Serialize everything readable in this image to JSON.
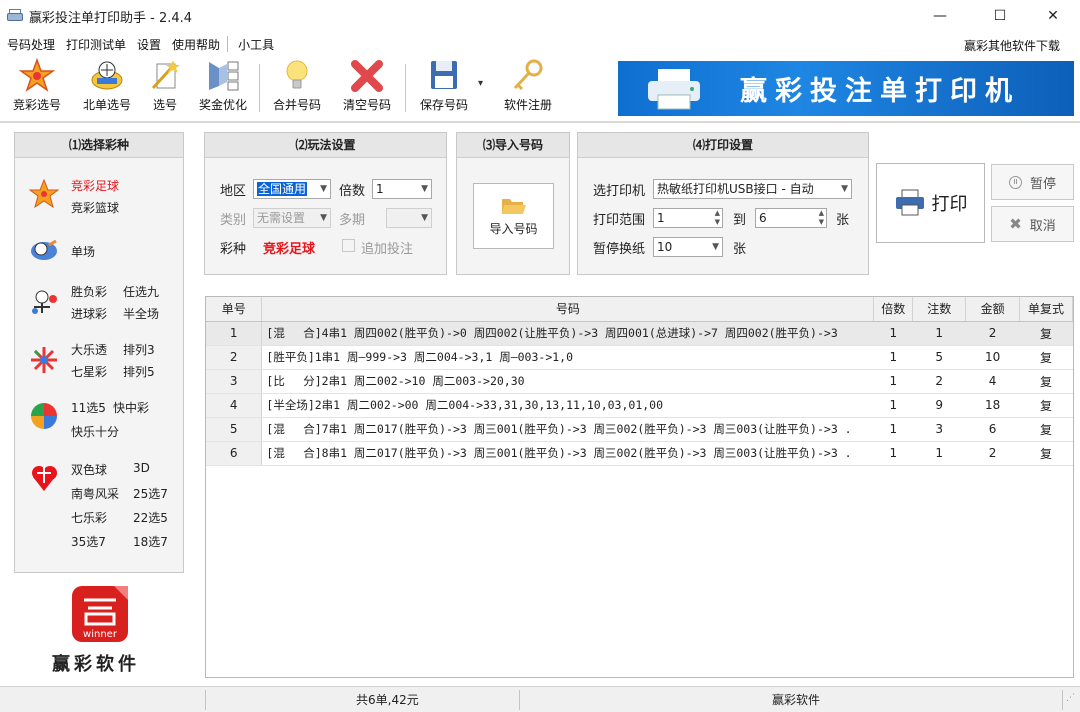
{
  "window": {
    "title": "赢彩投注单打印助手 - 2.4.4",
    "min": "—",
    "max": "☐",
    "close": "✕"
  },
  "menu": {
    "items": [
      "号码处理",
      "打印测试单",
      "设置",
      "使用帮助",
      "小工具"
    ],
    "right_link": "赢彩其他软件下载"
  },
  "toolbar": {
    "buttons": [
      "竞彩选号",
      "北单选号",
      "选号",
      "奖金优化",
      "合并号码",
      "清空号码",
      "保存号码",
      "软件注册"
    ],
    "save_dropdown": "▾"
  },
  "banner": {
    "text": "赢彩投注单打印机"
  },
  "sections": {
    "select_lottery": "⑴选择彩种",
    "play_settings": "⑵玩法设置",
    "import_numbers": "⑶导入号码",
    "print_settings": "⑷打印设置"
  },
  "lotteries": {
    "jingcai": [
      "竞彩足球",
      "竞彩篮球"
    ],
    "danchang": [
      "单场"
    ],
    "shengfu": [
      "胜负彩",
      "任选九",
      "进球彩",
      "半全场"
    ],
    "daletou": [
      "大乐透",
      "排列3",
      "七星彩",
      "排列5"
    ],
    "gaopin": [
      "11选5",
      "快中彩",
      "快乐十分"
    ],
    "fucai": [
      "双色球",
      "3D",
      "南粤风采",
      "25选7",
      "七乐彩",
      "22选5",
      "35选7",
      "18选7"
    ],
    "active_color": "#e8141b"
  },
  "logo": {
    "text": "赢彩软件",
    "badge": "winner"
  },
  "play": {
    "region_label": "地区",
    "region_value": "全国通用",
    "multiple_label": "倍数",
    "multiple_value": "1",
    "category_label": "类别",
    "category_value": "无需设置",
    "multi_period_label": "多期",
    "multi_period_value": "",
    "lottery_label": "彩种",
    "lottery_value": "竞彩足球",
    "extra_bet_label": "追加投注"
  },
  "import": {
    "button": "导入号码"
  },
  "print": {
    "printer_label": "选打印机",
    "printer_value": "热敏纸打印机USB接口 - 自动",
    "range_label": "打印范围",
    "range_from": "1",
    "range_to_label": "到",
    "range_to": "6",
    "range_unit": "张",
    "pause_label": "暂停换纸",
    "pause_value": "10",
    "pause_unit": "张",
    "print_button": "打印",
    "pause_button": "暂停",
    "cancel_button": "取消"
  },
  "grid": {
    "headers": [
      "单号",
      "号码",
      "倍数",
      "注数",
      "金额",
      "单复式"
    ],
    "rows": [
      {
        "id": "1",
        "code": "[混　 合]4串1 周四002(胜平负)->0 周四002(让胜平负)->3 周四001(总进球)->7 周四002(胜平负)->3",
        "mult": "1",
        "bets": "1",
        "amount": "2",
        "type": "复"
      },
      {
        "id": "2",
        "code": "[胜平负]1串1 周—999->3 周二004->3,1 周—003->1,0",
        "mult": "1",
        "bets": "5",
        "amount": "10",
        "type": "复"
      },
      {
        "id": "3",
        "code": "[比　 分]2串1 周二002->10 周二003->20,30",
        "mult": "1",
        "bets": "2",
        "amount": "4",
        "type": "复"
      },
      {
        "id": "4",
        "code": "[半全场]2串1 周二002->00 周二004->33,31,30,13,11,10,03,01,00",
        "mult": "1",
        "bets": "9",
        "amount": "18",
        "type": "复"
      },
      {
        "id": "5",
        "code": "[混　 合]7串1 周二017(胜平负)->3 周三001(胜平负)->3 周三002(胜平负)->3 周三003(让胜平负)->3 .",
        "mult": "1",
        "bets": "3",
        "amount": "6",
        "type": "复"
      },
      {
        "id": "6",
        "code": "[混　 合]8串1 周二017(胜平负)->3 周三001(胜平负)->3 周三002(胜平负)->3 周三003(让胜平负)->3 .",
        "mult": "1",
        "bets": "1",
        "amount": "2",
        "type": "复"
      }
    ]
  },
  "status": {
    "summary": "共6单,42元",
    "brand": "赢彩软件"
  }
}
